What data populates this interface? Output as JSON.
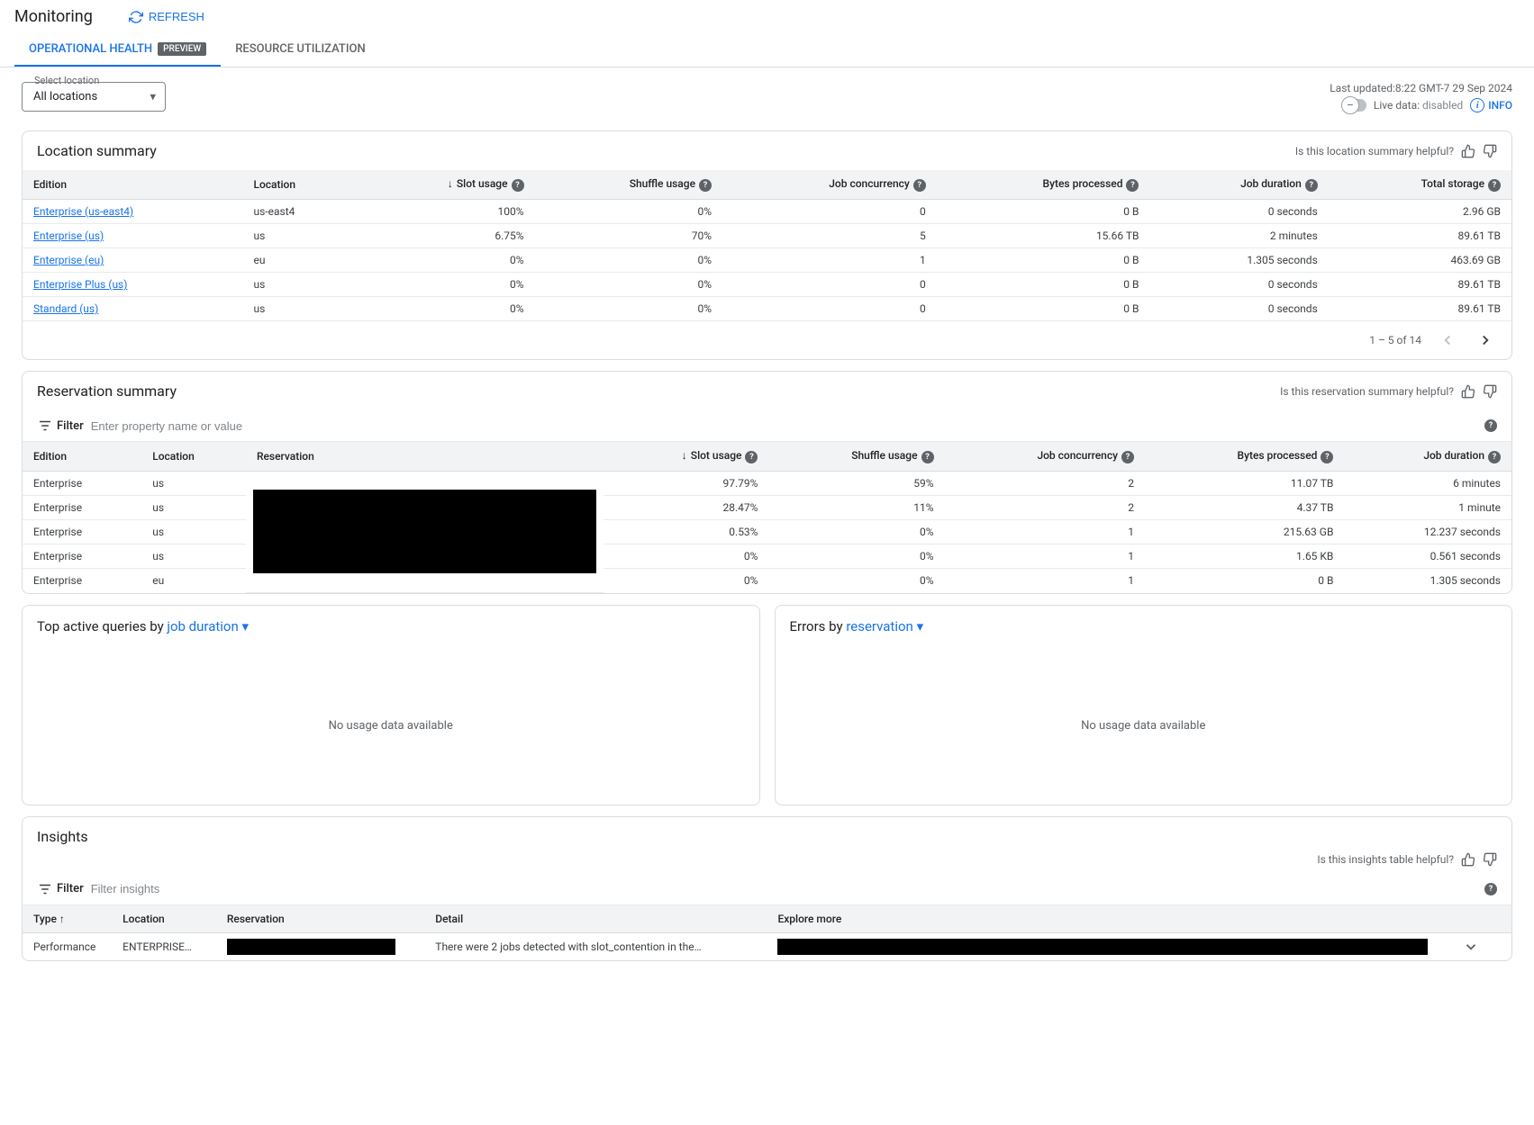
{
  "header": {
    "title": "Monitoring",
    "refresh": "REFRESH"
  },
  "tabs": {
    "operational": "OPERATIONAL HEALTH",
    "preview_badge": "PREVIEW",
    "resource": "RESOURCE UTILIZATION"
  },
  "location_select": {
    "label": "Select location",
    "value": "All locations"
  },
  "meta": {
    "last_updated_label": "Last updated:",
    "last_updated_value": "8:22 GMT-7 29 Sep 2024",
    "live_data_label": "Live data:",
    "live_data_value": "disabled",
    "info": "INFO"
  },
  "location_summary": {
    "title": "Location summary",
    "helpful": "Is this location summary helpful?",
    "columns": {
      "edition": "Edition",
      "location": "Location",
      "slot_usage": "Slot usage",
      "shuffle_usage": "Shuffle usage",
      "job_concurrency": "Job concurrency",
      "bytes_processed": "Bytes processed",
      "job_duration": "Job duration",
      "total_storage": "Total storage"
    },
    "rows": [
      {
        "edition": "Enterprise (us-east4)",
        "location": "us-east4",
        "slot": "100%",
        "shuffle": "0%",
        "jobs": "0",
        "bytes": "0 B",
        "duration": "0 seconds",
        "storage": "2.96 GB"
      },
      {
        "edition": "Enterprise (us)",
        "location": "us",
        "slot": "6.75%",
        "shuffle": "70%",
        "jobs": "5",
        "bytes": "15.66 TB",
        "duration": "2 minutes",
        "storage": "89.61 TB"
      },
      {
        "edition": "Enterprise (eu)",
        "location": "eu",
        "slot": "0%",
        "shuffle": "0%",
        "jobs": "1",
        "bytes": "0 B",
        "duration": "1.305 seconds",
        "storage": "463.69 GB"
      },
      {
        "edition": "Enterprise Plus (us)",
        "location": "us",
        "slot": "0%",
        "shuffle": "0%",
        "jobs": "0",
        "bytes": "0 B",
        "duration": "0 seconds",
        "storage": "89.61 TB"
      },
      {
        "edition": "Standard (us)",
        "location": "us",
        "slot": "0%",
        "shuffle": "0%",
        "jobs": "0",
        "bytes": "0 B",
        "duration": "0 seconds",
        "storage": "89.61 TB"
      }
    ],
    "pagination": "1 – 5 of 14"
  },
  "reservation_summary": {
    "title": "Reservation summary",
    "helpful": "Is this reservation summary helpful?",
    "filter_label": "Filter",
    "filter_placeholder": "Enter property name or value",
    "columns": {
      "edition": "Edition",
      "location": "Location",
      "reservation": "Reservation",
      "slot_usage": "Slot usage",
      "shuffle_usage": "Shuffle usage",
      "job_concurrency": "Job concurrency",
      "bytes_processed": "Bytes processed",
      "job_duration": "Job duration"
    },
    "rows": [
      {
        "edition": "Enterprise",
        "location": "us",
        "slot": "97.79%",
        "shuffle": "59%",
        "jobs": "2",
        "bytes": "11.07 TB",
        "duration": "6 minutes"
      },
      {
        "edition": "Enterprise",
        "location": "us",
        "slot": "28.47%",
        "shuffle": "11%",
        "jobs": "2",
        "bytes": "4.37 TB",
        "duration": "1 minute"
      },
      {
        "edition": "Enterprise",
        "location": "us",
        "slot": "0.53%",
        "shuffle": "0%",
        "jobs": "1",
        "bytes": "215.63 GB",
        "duration": "12.237 seconds"
      },
      {
        "edition": "Enterprise",
        "location": "us",
        "slot": "0%",
        "shuffle": "0%",
        "jobs": "1",
        "bytes": "1.65 KB",
        "duration": "0.561 seconds"
      },
      {
        "edition": "Enterprise",
        "location": "eu",
        "slot": "0%",
        "shuffle": "0%",
        "jobs": "1",
        "bytes": "0 B",
        "duration": "1.305 seconds"
      }
    ]
  },
  "top_queries": {
    "prefix": "Top active queries by ",
    "dropdown": "job duration",
    "empty": "No usage data available"
  },
  "errors": {
    "prefix": "Errors by ",
    "dropdown": "reservation",
    "empty": "No usage data available"
  },
  "insights": {
    "title": "Insights",
    "helpful": "Is this insights table helpful?",
    "filter_label": "Filter",
    "filter_placeholder": "Filter insights",
    "columns": {
      "type": "Type",
      "location": "Location",
      "reservation": "Reservation",
      "detail": "Detail",
      "explore": "Explore more"
    },
    "rows": [
      {
        "type": "Performance",
        "location": "ENTERPRISE…",
        "detail": "There were 2 jobs detected with slot_contention in the…"
      }
    ]
  }
}
